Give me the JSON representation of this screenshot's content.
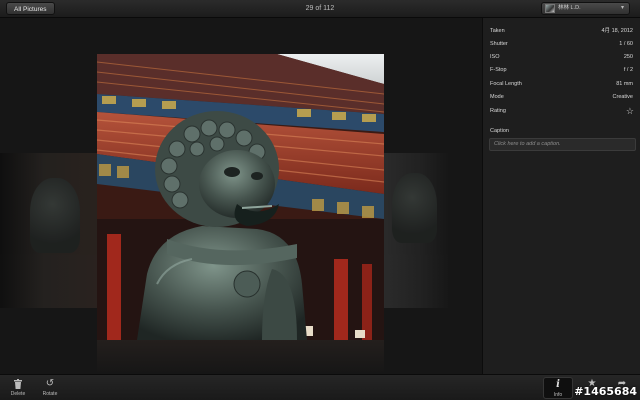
{
  "topbar": {
    "all_pictures_label": "All Pictures",
    "counter": "29 of 112",
    "account_name": "林林 L.D."
  },
  "info": {
    "rows": [
      {
        "key": "Taken",
        "value": "4月 18, 2012"
      },
      {
        "key": "Shutter",
        "value": "1 / 60"
      },
      {
        "key": "ISO",
        "value": "250"
      },
      {
        "key": "F-Stop",
        "value": "f / 2"
      },
      {
        "key": "Focal Length",
        "value": "81 mm"
      },
      {
        "key": "Mode",
        "value": "Creative"
      }
    ],
    "rating_label": "Rating",
    "rating_icon": "star-outline-icon",
    "caption_label": "Caption",
    "caption_placeholder": "Click here to add a caption."
  },
  "toolbar": {
    "delete_label": "Delete",
    "rotate_label": "Rotate",
    "info_label": "Info",
    "favorite_icon": "star-icon",
    "share_icon": "share-icon"
  },
  "watermark": "#1465684"
}
